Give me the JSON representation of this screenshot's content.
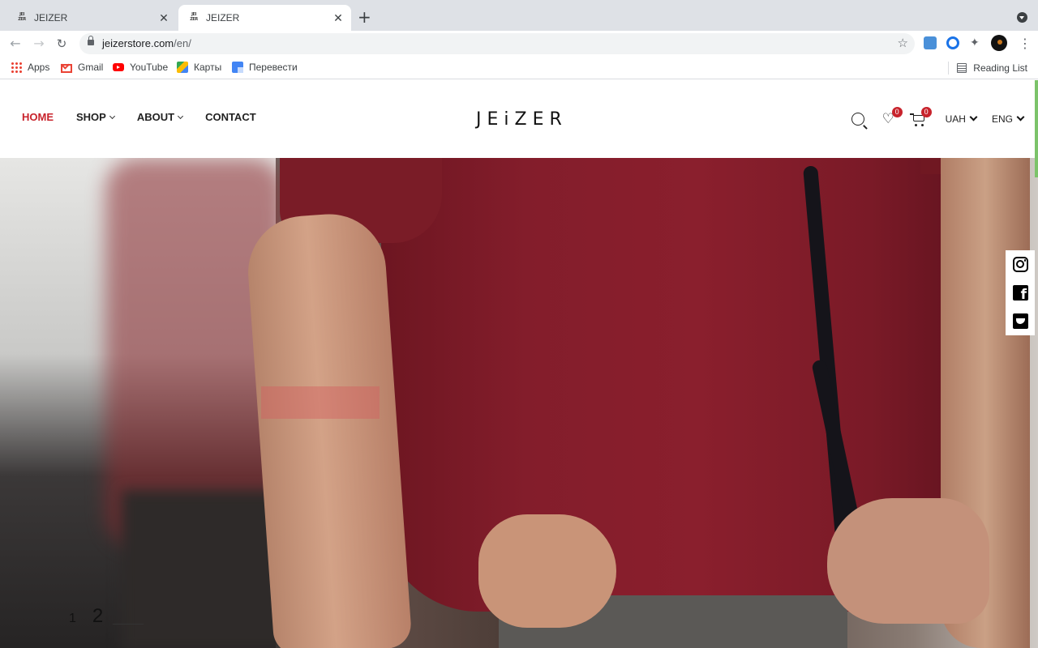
{
  "browser": {
    "tabs": [
      {
        "title": "JEIZER",
        "favicon": "JEI ZER"
      },
      {
        "title": "JEIZER",
        "favicon": "JEI ZER",
        "active": true
      }
    ],
    "url_host": "jeizerstore.com",
    "url_path": "/en/",
    "bookmarks": [
      {
        "label": "Apps",
        "icon": "apps-icon"
      },
      {
        "label": "Gmail",
        "icon": "gmail-icon"
      },
      {
        "label": "YouTube",
        "icon": "youtube-icon"
      },
      {
        "label": "Карты",
        "icon": "maps-icon"
      },
      {
        "label": "Перевести",
        "icon": "translate-icon"
      }
    ],
    "reading_list": "Reading List"
  },
  "site": {
    "logo": "JEiZER",
    "nav": [
      {
        "label": "HOME",
        "active": true
      },
      {
        "label": "SHOP",
        "dropdown": true
      },
      {
        "label": "ABOUT",
        "dropdown": true
      },
      {
        "label": "CONTACT"
      }
    ],
    "wishlist_count": "0",
    "cart_count": "0",
    "currency": "UAH",
    "language": "ENG",
    "accent_color": "#c8232c"
  },
  "hero": {
    "slides": [
      "1",
      "2"
    ],
    "active_slide": "2",
    "social": [
      "instagram-icon",
      "facebook-icon",
      "twitter-icon"
    ]
  }
}
